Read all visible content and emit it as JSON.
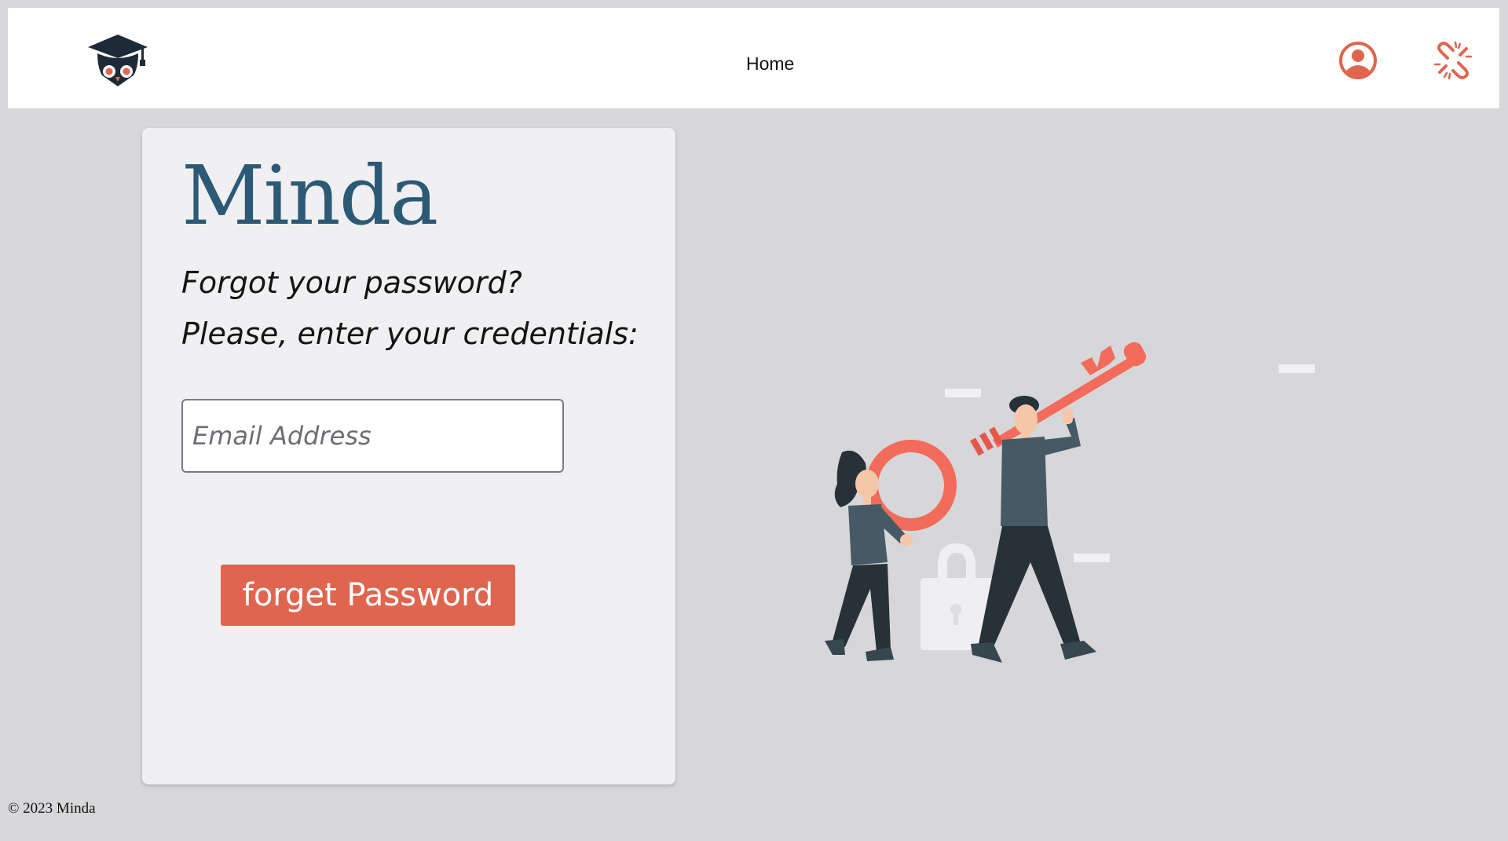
{
  "nav": {
    "home_label": "Home",
    "icons": [
      "graduation-owl-logo",
      "user-circle-icon",
      "unlink-icon"
    ]
  },
  "card": {
    "brand": "Minda",
    "prompt_line1": "Forgot your password?",
    "prompt_line2": "Please, enter your credentials:",
    "email_placeholder": "Email Address",
    "email_value": "",
    "submit_label": "forget Password"
  },
  "footer": {
    "copyright": "© 2023 Minda"
  },
  "colors": {
    "page_bg": "#d7d6d9",
    "card_bg": "#f0eff1",
    "brand": "#2c5a76",
    "accent": "#e0654e",
    "navy": "#1f2a38"
  }
}
